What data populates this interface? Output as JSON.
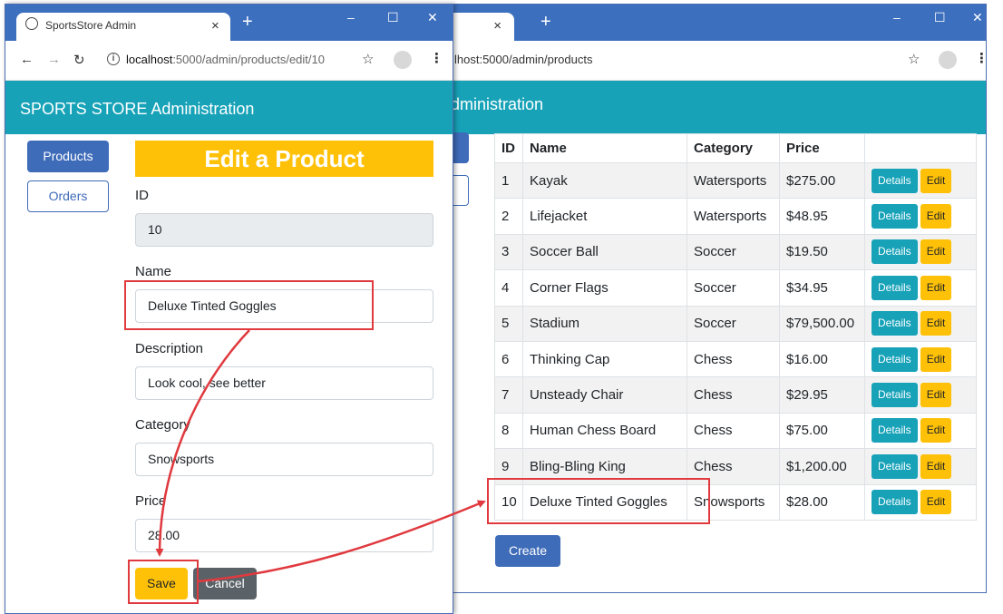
{
  "back_window": {
    "tab_close": "×",
    "new_tab": "+",
    "url": "lhost:5000/admin/products",
    "header": "dministration",
    "table": {
      "columns": [
        "ID",
        "Name",
        "Category",
        "Price"
      ],
      "rows": [
        {
          "id": "1",
          "name": "Kayak",
          "category": "Watersports",
          "price": "$275.00"
        },
        {
          "id": "2",
          "name": "Lifejacket",
          "category": "Watersports",
          "price": "$48.95"
        },
        {
          "id": "3",
          "name": "Soccer Ball",
          "category": "Soccer",
          "price": "$19.50"
        },
        {
          "id": "4",
          "name": "Corner Flags",
          "category": "Soccer",
          "price": "$34.95"
        },
        {
          "id": "5",
          "name": "Stadium",
          "category": "Soccer",
          "price": "$79,500.00"
        },
        {
          "id": "6",
          "name": "Thinking Cap",
          "category": "Chess",
          "price": "$16.00"
        },
        {
          "id": "7",
          "name": "Unsteady Chair",
          "category": "Chess",
          "price": "$29.95"
        },
        {
          "id": "8",
          "name": "Human Chess Board",
          "category": "Chess",
          "price": "$75.00"
        },
        {
          "id": "9",
          "name": "Bling-Bling King",
          "category": "Chess",
          "price": "$1,200.00"
        },
        {
          "id": "10",
          "name": "Deluxe Tinted Goggles",
          "category": "Snowsports",
          "price": "$28.00"
        }
      ],
      "details_label": "Details",
      "edit_label": "Edit"
    },
    "create_label": "Create"
  },
  "front_window": {
    "tab_title": "SportsStore Admin",
    "tab_close": "×",
    "new_tab": "+",
    "url_host": "localhost",
    "url_path": ":5000/admin/products/edit/10",
    "header": "SPORTS STORE Administration",
    "nav": {
      "products": "Products",
      "orders": "Orders"
    },
    "form": {
      "title": "Edit a Product",
      "id_label": "ID",
      "id_value": "10",
      "name_label": "Name",
      "name_value": "Deluxe Tinted Goggles",
      "description_label": "Description",
      "description_value": "Look cool, see better",
      "category_label": "Category",
      "category_value": "Snowsports",
      "price_label": "Price",
      "price_value": "28.00",
      "save_label": "Save",
      "cancel_label": "Cancel"
    }
  },
  "window_controls": {
    "minimize": "–",
    "maximize": "☐",
    "close": "✕"
  },
  "colors": {
    "chrome_bar": "#3c6fbe",
    "app_header": "#17a2b8",
    "primary": "#3f6cb9",
    "warning": "#ffc107",
    "info": "#17a2b8",
    "secondary": "#5a6268",
    "highlight": "#e0393e"
  },
  "icons": [
    "globe-icon",
    "back-icon",
    "forward-icon",
    "reload-icon",
    "info-icon",
    "star-icon",
    "profile-icon",
    "menu-icon"
  ]
}
